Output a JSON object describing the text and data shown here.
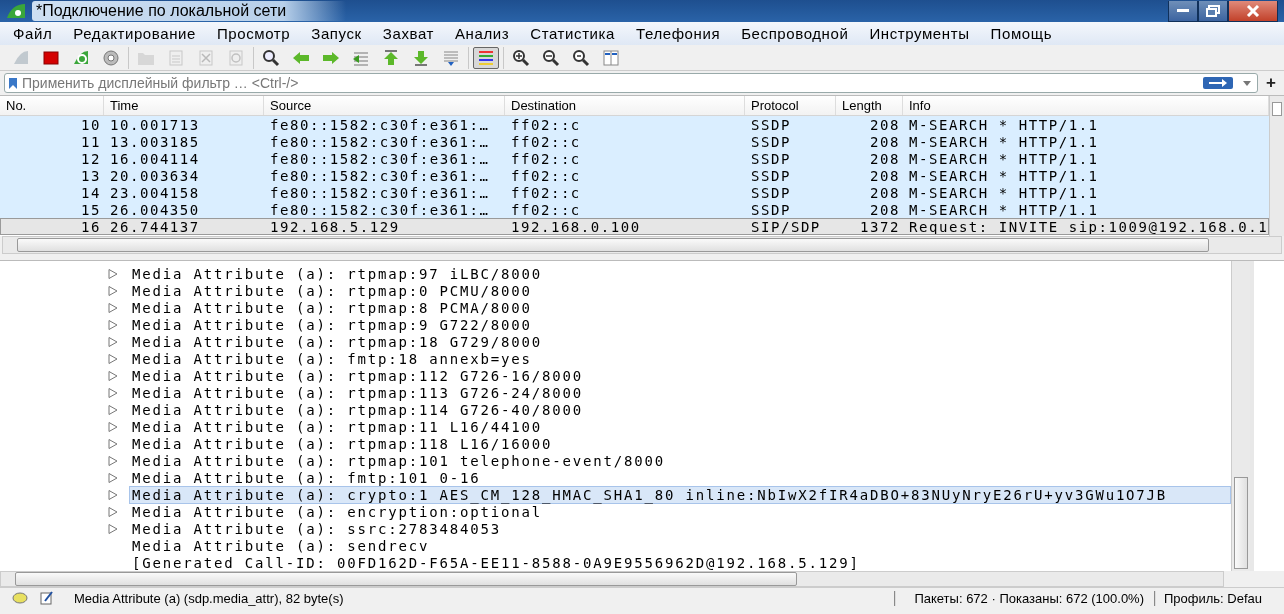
{
  "window": {
    "title": "*Подключение по локальной сети"
  },
  "menu": [
    "Файл",
    "Редактирование",
    "Просмотр",
    "Запуск",
    "Захват",
    "Анализ",
    "Статистика",
    "Телефония",
    "Беспроводной",
    "Инструменты",
    "Помощь"
  ],
  "toolbar": [
    [
      {
        "kind": "fin",
        "disabled": true
      },
      {
        "kind": "stop",
        "disabled": false
      },
      {
        "kind": "restart",
        "disabled": false
      },
      {
        "kind": "options",
        "disabled": false
      }
    ],
    [
      {
        "kind": "open",
        "disabled": true
      },
      {
        "kind": "file",
        "disabled": true
      },
      {
        "kind": "close",
        "disabled": true
      },
      {
        "kind": "reload",
        "disabled": true
      }
    ],
    [
      {
        "kind": "find",
        "disabled": false
      },
      {
        "kind": "back",
        "disabled": false
      },
      {
        "kind": "forward",
        "disabled": false
      },
      {
        "kind": "goto",
        "disabled": false
      },
      {
        "kind": "first",
        "disabled": false
      },
      {
        "kind": "last",
        "disabled": false
      },
      {
        "kind": "autoscroll",
        "disabled": false
      }
    ],
    [
      {
        "kind": "colorize",
        "disabled": false,
        "pressed": true
      }
    ],
    [
      {
        "kind": "zoom-in",
        "disabled": false
      },
      {
        "kind": "zoom-out",
        "disabled": false
      },
      {
        "kind": "zoom-reset",
        "disabled": false
      },
      {
        "kind": "resize",
        "disabled": false
      }
    ]
  ],
  "filter": {
    "placeholder": "Применить дисплейный фильтр … <Ctrl-/>",
    "add_button": "+"
  },
  "packet_list": {
    "columns": [
      "No.",
      "Time",
      "Source",
      "Destination",
      "Protocol",
      "Length",
      "Info"
    ],
    "rows": [
      {
        "no": "10",
        "time": "10.001713",
        "source": "fe80::1582:c30f:e361:…",
        "destination": "ff02::c",
        "protocol": "SSDP",
        "length": "208",
        "info": "M-SEARCH * HTTP/1.1",
        "color": "#daeeff",
        "selected": false
      },
      {
        "no": "11",
        "time": "13.003185",
        "source": "fe80::1582:c30f:e361:…",
        "destination": "ff02::c",
        "protocol": "SSDP",
        "length": "208",
        "info": "M-SEARCH * HTTP/1.1",
        "color": "#daeeff",
        "selected": false
      },
      {
        "no": "12",
        "time": "16.004114",
        "source": "fe80::1582:c30f:e361:…",
        "destination": "ff02::c",
        "protocol": "SSDP",
        "length": "208",
        "info": "M-SEARCH * HTTP/1.1",
        "color": "#daeeff",
        "selected": false
      },
      {
        "no": "13",
        "time": "20.003634",
        "source": "fe80::1582:c30f:e361:…",
        "destination": "ff02::c",
        "protocol": "SSDP",
        "length": "208",
        "info": "M-SEARCH * HTTP/1.1",
        "color": "#daeeff",
        "selected": false
      },
      {
        "no": "14",
        "time": "23.004158",
        "source": "fe80::1582:c30f:e361:…",
        "destination": "ff02::c",
        "protocol": "SSDP",
        "length": "208",
        "info": "M-SEARCH * HTTP/1.1",
        "color": "#daeeff",
        "selected": false
      },
      {
        "no": "15",
        "time": "26.004350",
        "source": "fe80::1582:c30f:e361:…",
        "destination": "ff02::c",
        "protocol": "SSDP",
        "length": "208",
        "info": "M-SEARCH * HTTP/1.1",
        "color": "#daeeff",
        "selected": false
      },
      {
        "no": "16",
        "time": "26.744137",
        "source": "192.168.5.129",
        "destination": "192.168.0.100",
        "protocol": "SIP/SDP",
        "length": "1372",
        "info": "Request: INVITE sip:1009@192.168.0.1",
        "color": "#e6e6e6",
        "selected": true
      }
    ]
  },
  "details": [
    {
      "text": "Media Attribute (a): rtpmap:97 iLBC/8000",
      "expandable": true,
      "selected": false
    },
    {
      "text": "Media Attribute (a): rtpmap:0 PCMU/8000",
      "expandable": true,
      "selected": false
    },
    {
      "text": "Media Attribute (a): rtpmap:8 PCMA/8000",
      "expandable": true,
      "selected": false
    },
    {
      "text": "Media Attribute (a): rtpmap:9 G722/8000",
      "expandable": true,
      "selected": false
    },
    {
      "text": "Media Attribute (a): rtpmap:18 G729/8000",
      "expandable": true,
      "selected": false
    },
    {
      "text": "Media Attribute (a): fmtp:18 annexb=yes",
      "expandable": true,
      "selected": false
    },
    {
      "text": "Media Attribute (a): rtpmap:112 G726-16/8000",
      "expandable": true,
      "selected": false
    },
    {
      "text": "Media Attribute (a): rtpmap:113 G726-24/8000",
      "expandable": true,
      "selected": false
    },
    {
      "text": "Media Attribute (a): rtpmap:114 G726-40/8000",
      "expandable": true,
      "selected": false
    },
    {
      "text": "Media Attribute (a): rtpmap:11 L16/44100",
      "expandable": true,
      "selected": false
    },
    {
      "text": "Media Attribute (a): rtpmap:118 L16/16000",
      "expandable": true,
      "selected": false
    },
    {
      "text": "Media Attribute (a): rtpmap:101 telephone-event/8000",
      "expandable": true,
      "selected": false
    },
    {
      "text": "Media Attribute (a): fmtp:101 0-16",
      "expandable": true,
      "selected": false
    },
    {
      "text": "Media Attribute (a): crypto:1 AES_CM_128_HMAC_SHA1_80 inline:NbIwX2fIR4aDBO+83NUyNryE26rU+yv3GWu1O7JB",
      "expandable": true,
      "selected": true
    },
    {
      "text": "Media Attribute (a): encryption:optional",
      "expandable": true,
      "selected": false
    },
    {
      "text": "Media Attribute (a): ssrc:2783484053",
      "expandable": true,
      "selected": false
    },
    {
      "text": "Media Attribute (a): sendrecv",
      "expandable": false,
      "selected": false
    },
    {
      "text": "[Generated Call-ID: 00FD162D-F65A-EE11-8588-0A9E9556962D@192.168.5.129]",
      "expandable": false,
      "selected": false
    }
  ],
  "status_bar": {
    "field": "Media Attribute (a) (sdp.media_attr), 82 byte(s)",
    "packets": "Пакеты: 672 · Показаны: 672 (100.0%)",
    "profile": "Профиль: Defau"
  }
}
